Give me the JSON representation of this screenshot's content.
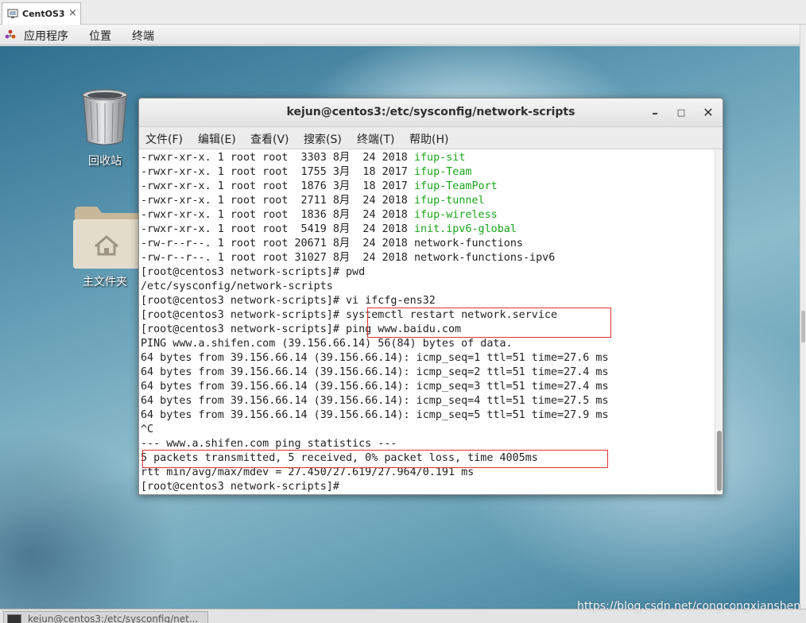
{
  "vm_tab": {
    "label": "CentOS3",
    "close": "×"
  },
  "panel": {
    "applications": "应用程序",
    "places": "位置",
    "terminal": "终端"
  },
  "desktop": {
    "trash_label": "回收站",
    "home_label": "主文件夹"
  },
  "window": {
    "title": "kejun@centos3:/etc/sysconfig/network-scripts",
    "minimize": "–",
    "maximize": "□",
    "close": "✕",
    "menu": [
      "文件(F)",
      "编辑(E)",
      "查看(V)",
      "搜索(S)",
      "终端(T)",
      "帮助(H)"
    ]
  },
  "terminal": {
    "listing": [
      {
        "perm": "-rwxr-xr-x. 1 root root  3303 8月  24 2018 ",
        "name": "ifup-sit",
        "exec": true
      },
      {
        "perm": "-rwxr-xr-x. 1 root root  1755 3月  18 2017 ",
        "name": "ifup-Team",
        "exec": true
      },
      {
        "perm": "-rwxr-xr-x. 1 root root  1876 3月  18 2017 ",
        "name": "ifup-TeamPort",
        "exec": true
      },
      {
        "perm": "-rwxr-xr-x. 1 root root  2711 8月  24 2018 ",
        "name": "ifup-tunnel",
        "exec": true
      },
      {
        "perm": "-rwxr-xr-x. 1 root root  1836 8月  24 2018 ",
        "name": "ifup-wireless",
        "exec": true
      },
      {
        "perm": "-rwxr-xr-x. 1 root root  5419 8月  24 2018 ",
        "name": "init.ipv6-global",
        "exec": true
      },
      {
        "perm": "-rw-r--r--. 1 root root 20671 8月  24 2018 ",
        "name": "network-functions",
        "exec": false
      },
      {
        "perm": "-rw-r--r--. 1 root root 31027 8月  24 2018 ",
        "name": "network-functions-ipv6",
        "exec": false
      }
    ],
    "lines": [
      "[root@centos3 network-scripts]# pwd",
      "/etc/sysconfig/network-scripts",
      "[root@centos3 network-scripts]# vi ifcfg-ens32",
      "[root@centos3 network-scripts]# systemctl restart network.service",
      "[root@centos3 network-scripts]# ping www.baidu.com",
      "PING www.a.shifen.com (39.156.66.14) 56(84) bytes of data.",
      "64 bytes from 39.156.66.14 (39.156.66.14): icmp_seq=1 ttl=51 time=27.6 ms",
      "64 bytes from 39.156.66.14 (39.156.66.14): icmp_seq=2 ttl=51 time=27.4 ms",
      "64 bytes from 39.156.66.14 (39.156.66.14): icmp_seq=3 ttl=51 time=27.4 ms",
      "64 bytes from 39.156.66.14 (39.156.66.14): icmp_seq=4 ttl=51 time=27.5 ms",
      "64 bytes from 39.156.66.14 (39.156.66.14): icmp_seq=5 ttl=51 time=27.9 ms",
      "^C",
      "--- www.a.shifen.com ping statistics ---",
      "5 packets transmitted, 5 received, 0% packet loss, time 4005ms",
      "rtt min/avg/max/mdev = 27.450/27.619/27.964/0.191 ms",
      "[root@centos3 network-scripts]#"
    ]
  },
  "taskbar": {
    "item_label": "kejun@centos3:/etc/sysconfig/net..."
  },
  "watermark": "https://blog.csdn.net/congcongxianshen",
  "colors": {
    "exec_file": "#1aa51a",
    "highlight_box": "#e03232"
  }
}
